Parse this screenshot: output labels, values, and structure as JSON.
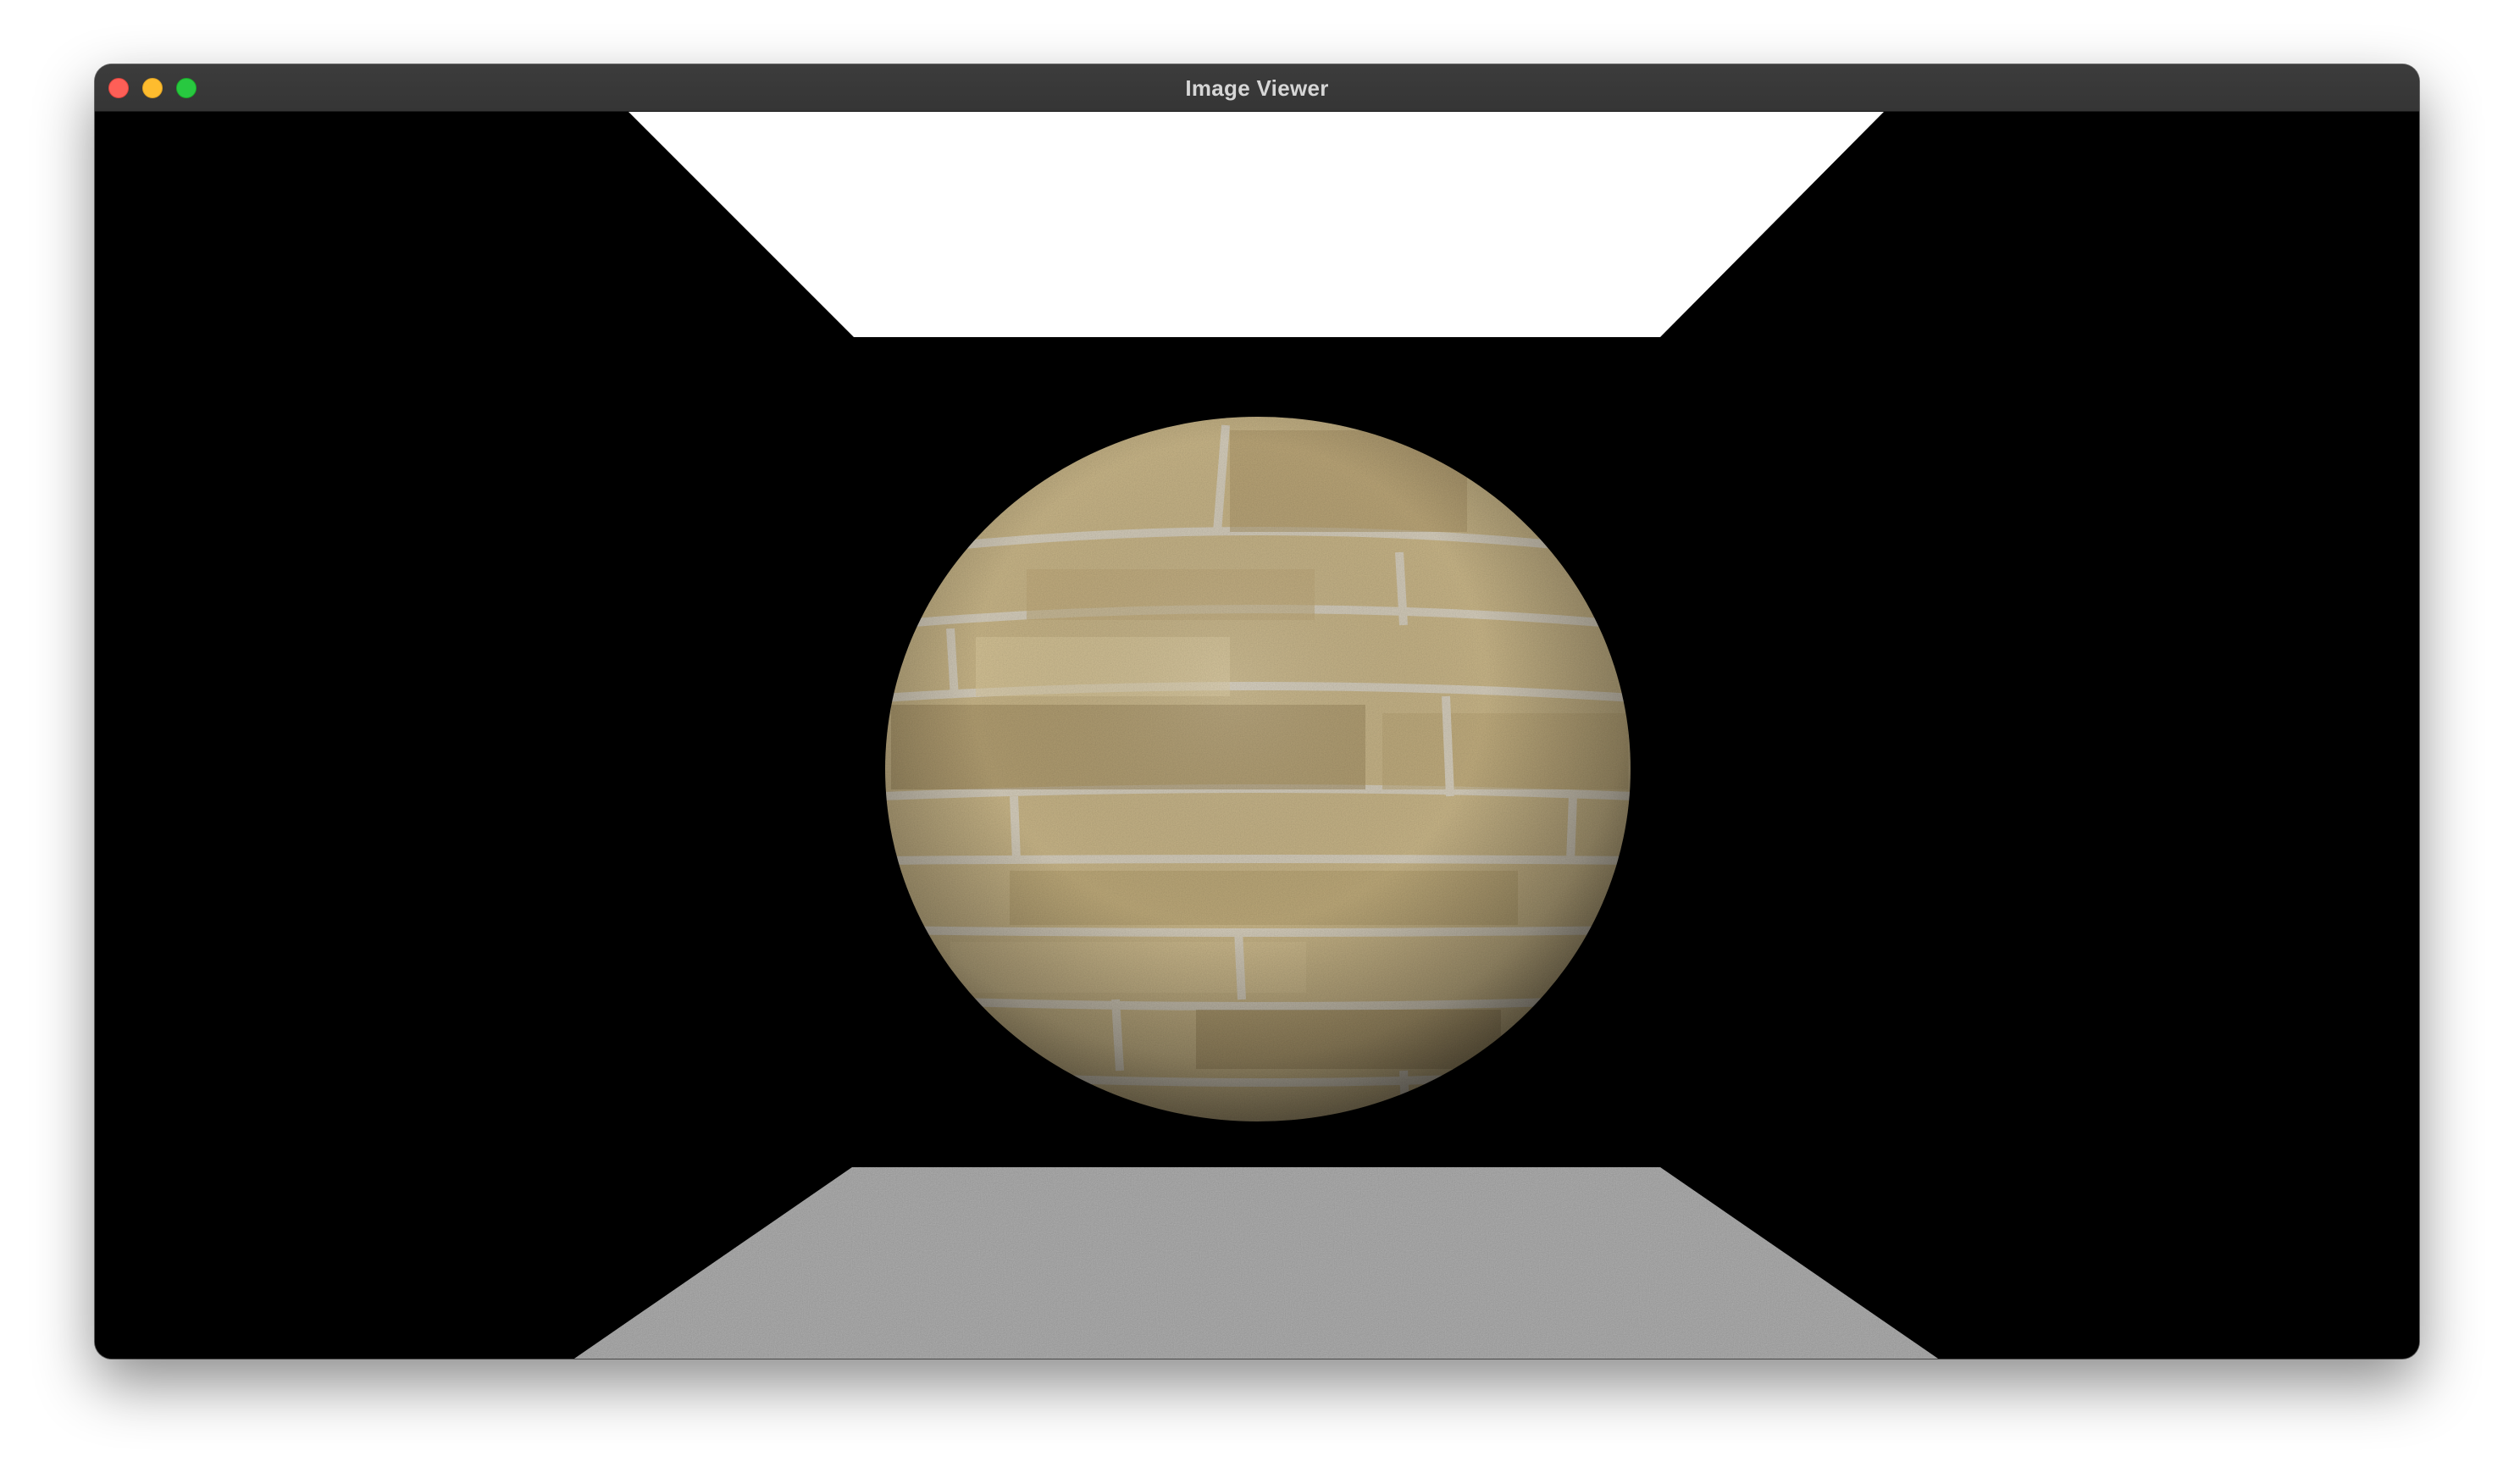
{
  "window": {
    "title": "Image Viewer"
  },
  "colors": {
    "titlebar": "#3a3a3a",
    "title_text": "#d6d6d6",
    "close": "#fe5f57",
    "minimize": "#febc2e",
    "zoom": "#28c840",
    "background": "#000000",
    "ceiling_light": "#ffffff",
    "floor": "#b4b4b4",
    "stone_light": "#d9c79a",
    "stone_dark": "#8f7c54",
    "mortar": "#c8c0ae"
  },
  "icons": {
    "close": "close-icon",
    "minimize": "minimize-icon",
    "zoom": "zoom-icon"
  }
}
